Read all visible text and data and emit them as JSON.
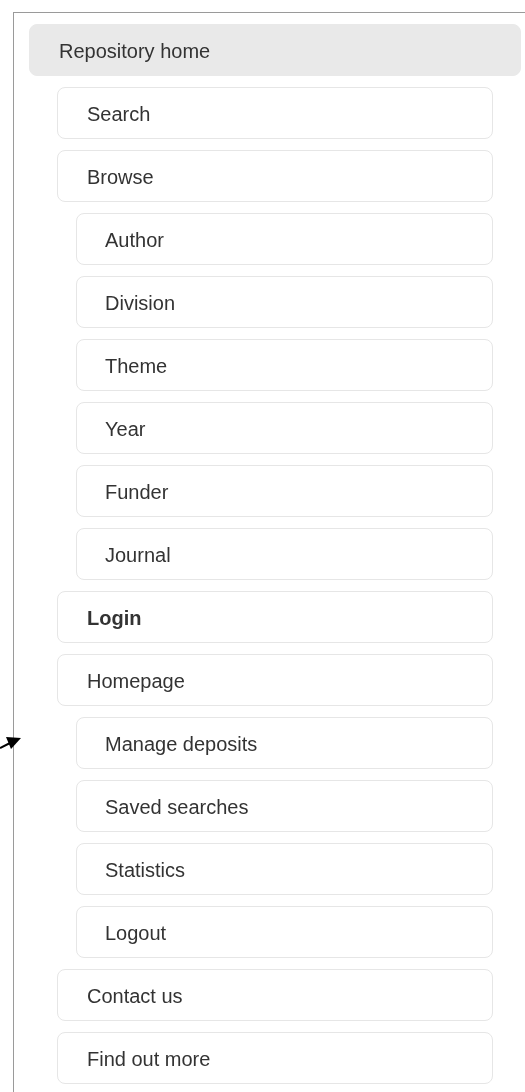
{
  "menu": [
    {
      "label": "Repository home",
      "selected": true,
      "bold": false,
      "children": [
        {
          "label": "Search",
          "selected": false,
          "bold": false
        },
        {
          "label": "Browse",
          "selected": false,
          "bold": false,
          "children": [
            {
              "label": "Author",
              "selected": false,
              "bold": false
            },
            {
              "label": "Division",
              "selected": false,
              "bold": false
            },
            {
              "label": "Theme",
              "selected": false,
              "bold": false
            },
            {
              "label": "Year",
              "selected": false,
              "bold": false
            },
            {
              "label": "Funder",
              "selected": false,
              "bold": false
            },
            {
              "label": "Journal",
              "selected": false,
              "bold": false
            }
          ]
        },
        {
          "label": "Login",
          "selected": false,
          "bold": true
        },
        {
          "label": "Homepage",
          "selected": false,
          "bold": false,
          "children": [
            {
              "label": "Manage deposits",
              "selected": false,
              "bold": false
            },
            {
              "label": "Saved searches",
              "selected": false,
              "bold": false
            },
            {
              "label": "Statistics",
              "selected": false,
              "bold": false
            },
            {
              "label": "Logout",
              "selected": false,
              "bold": false
            }
          ]
        },
        {
          "label": "Contact us",
          "selected": false,
          "bold": false
        },
        {
          "label": "Find out more",
          "selected": false,
          "bold": false
        }
      ]
    }
  ]
}
